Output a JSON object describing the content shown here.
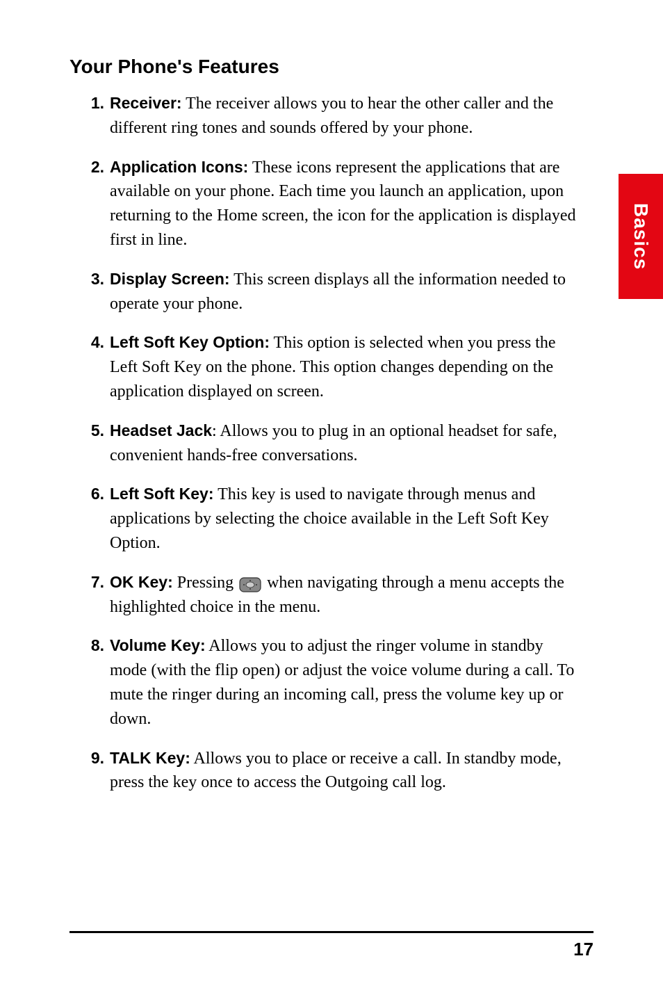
{
  "section_title": "Your Phone's Features",
  "side_tab": "Basics",
  "page_number": "17",
  "items": [
    {
      "number": "1.",
      "label": "Receiver:",
      "text": " The receiver allows you to hear the other caller and the different ring tones and sounds offered by your phone."
    },
    {
      "number": "2.",
      "label": "Application Icons:",
      "text": " These icons represent the applications that are available on your phone. Each time you launch an application, upon returning to the Home screen, the icon for the application is displayed first in line."
    },
    {
      "number": "3.",
      "label": "Display Screen:",
      "text": " This screen displays all the information needed to operate your phone."
    },
    {
      "number": "4.",
      "label": "Left Soft Key Option:",
      "text": " This option is selected when you press the Left Soft Key on the phone. This option changes depending on the application displayed on screen."
    },
    {
      "number": "5.",
      "label": "Headset Jack",
      "text": ": Allows you to plug in an optional headset for safe, convenient hands-free conversations."
    },
    {
      "number": "6.",
      "label": "Left Soft Key:",
      "text": " This key is used to navigate through menus and applications by selecting the choice available in the Left Soft Key Option."
    },
    {
      "number": "7.",
      "label": "OK Key:",
      "text_before": " Pressing ",
      "text_after": " when navigating through a menu accepts the highlighted choice in the menu."
    },
    {
      "number": "8.",
      "label": "Volume Key:",
      "text": " Allows you to adjust the ringer volume in standby mode (with the flip open) or adjust the voice volume during a call. To mute the ringer during an incoming call, press the volume key up or down."
    },
    {
      "number": "9.",
      "label": "TALK Key:",
      "text": " Allows you to place or receive a call. In standby mode, press the key once to access the Outgoing call log."
    }
  ]
}
